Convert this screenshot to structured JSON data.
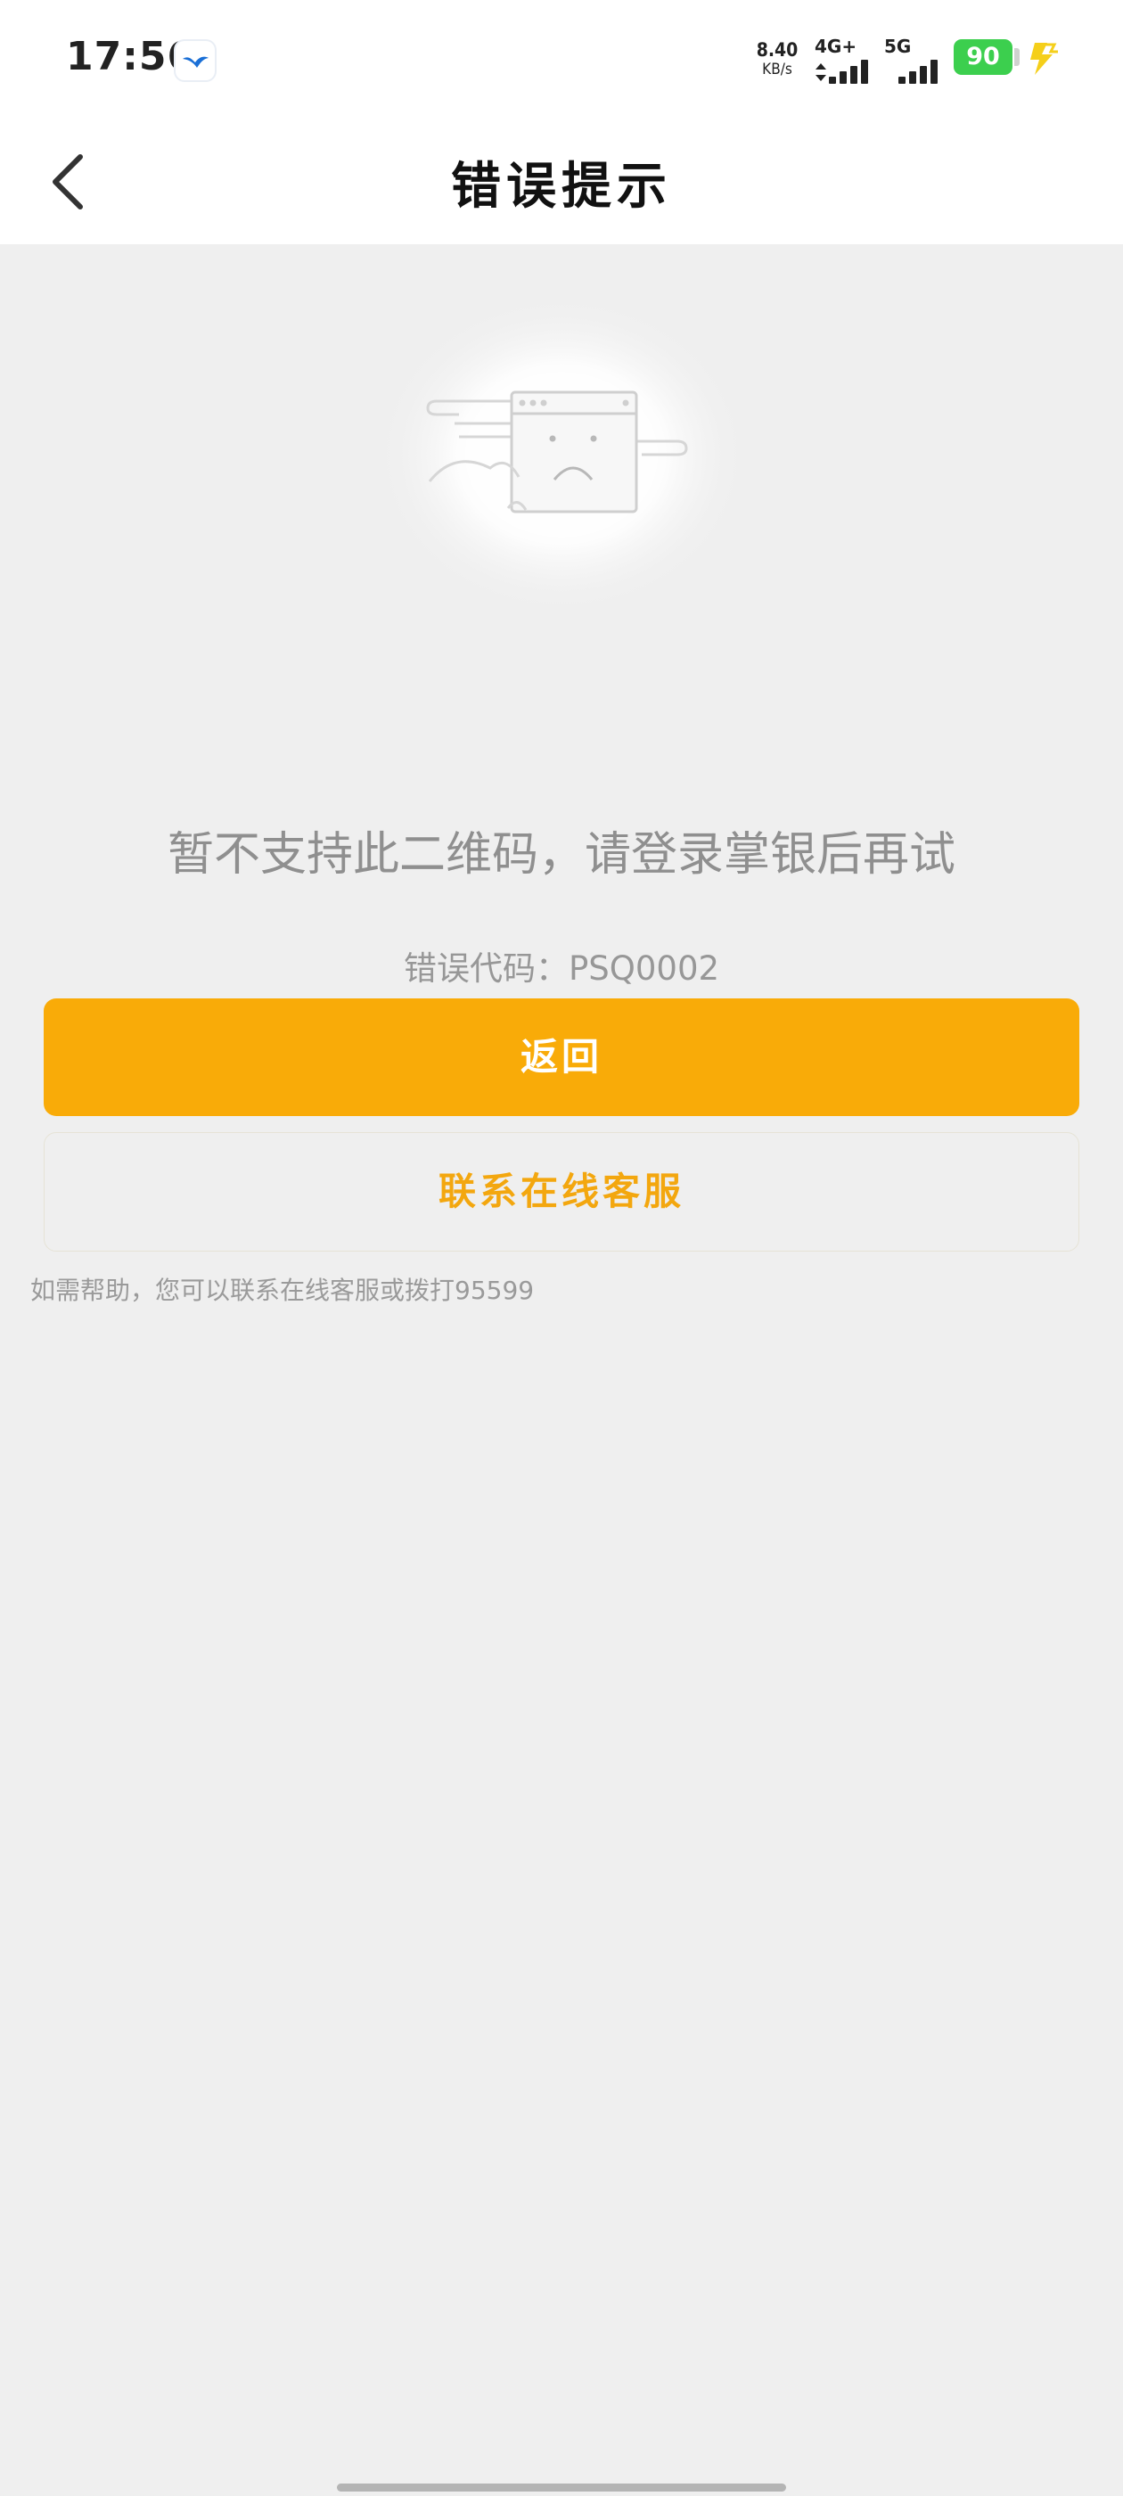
{
  "status_bar": {
    "time": "17:56",
    "net_speed_value": "8.40",
    "net_speed_unit": "KB/s",
    "signal_1_label": "4G+",
    "signal_2_label": "5G",
    "battery_level": "90",
    "battery_color": "#3ccf4e",
    "icons": [
      "notify-bird-icon",
      "signal-icon",
      "battery-icon",
      "charging-icon"
    ]
  },
  "nav": {
    "title": "错误提示",
    "back_icon": "chevron-left-icon"
  },
  "illustration": {
    "icon": "sad-browser-window-icon"
  },
  "error": {
    "message": "暂不支持此二维码，请登录掌银后再试",
    "code": "错误代码：PSQ0002"
  },
  "actions": {
    "return_label": "返回",
    "contact_label": "联系在线客服",
    "accent_color": "#f9ab08"
  },
  "help": {
    "text": "如需帮助，您可以联系在线客服或拨打95599"
  }
}
